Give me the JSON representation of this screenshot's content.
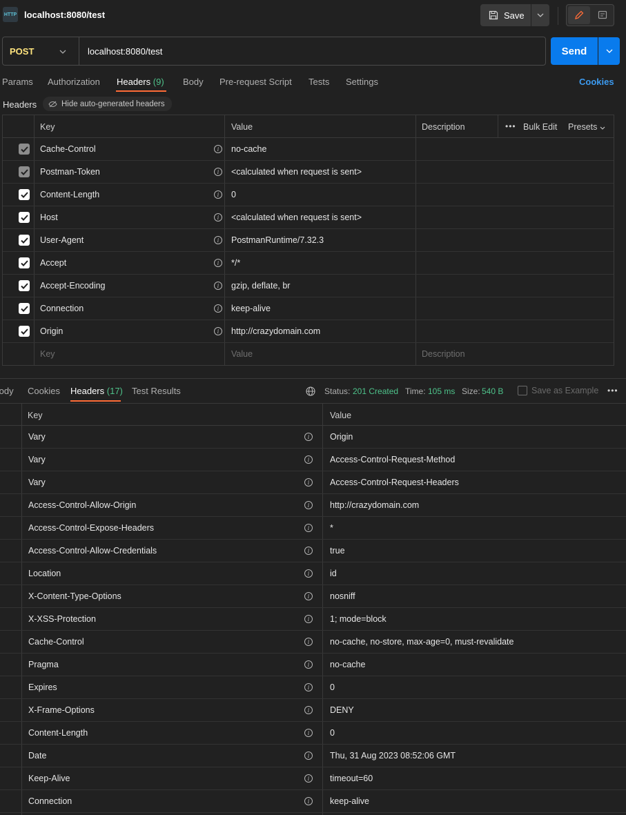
{
  "app": {
    "tab_icon": "HTTP",
    "tab_title": "localhost:8080/test",
    "save_label": "Save"
  },
  "request": {
    "method": "POST",
    "url": "localhost:8080/test",
    "send_label": "Send"
  },
  "request_tabs": [
    {
      "label": "Params"
    },
    {
      "label": "Authorization"
    },
    {
      "label": "Headers",
      "count": "(9)"
    },
    {
      "label": "Body"
    },
    {
      "label": "Pre-request Script"
    },
    {
      "label": "Tests"
    },
    {
      "label": "Settings"
    }
  ],
  "cookies_label": "Cookies",
  "headers_section": {
    "label": "Headers",
    "hide_auto_label": "Hide auto-generated headers"
  },
  "req_table": {
    "columns": {
      "key": "Key",
      "value": "Value",
      "description": "Description"
    },
    "bulk_edit": "Bulk Edit",
    "presets": "Presets",
    "rows": [
      {
        "key": "Cache-Control",
        "value": "no-cache",
        "auto": true
      },
      {
        "key": "Postman-Token",
        "value": "<calculated when request is sent>",
        "auto": true
      },
      {
        "key": "Content-Length",
        "value": "0",
        "auto": false
      },
      {
        "key": "Host",
        "value": "<calculated when request is sent>",
        "auto": false
      },
      {
        "key": "User-Agent",
        "value": "PostmanRuntime/7.32.3",
        "auto": false
      },
      {
        "key": "Accept",
        "value": "*/*",
        "auto": false
      },
      {
        "key": "Accept-Encoding",
        "value": "gzip, deflate, br",
        "auto": false
      },
      {
        "key": "Connection",
        "value": "keep-alive",
        "auto": false
      },
      {
        "key": "Origin",
        "value": "http://crazydomain.com",
        "auto": false
      }
    ],
    "placeholders": {
      "key": "Key",
      "value": "Value",
      "description": "Description"
    }
  },
  "response": {
    "tabs": [
      {
        "label": "Body"
      },
      {
        "label": "Cookies"
      },
      {
        "label": "Headers",
        "count": "(17)"
      },
      {
        "label": "Test Results"
      }
    ],
    "status_label": "Status:",
    "status_value": "201 Created",
    "time_label": "Time:",
    "time_value": "105 ms",
    "size_label": "Size:",
    "size_value": "540 B",
    "save_example": "Save as Example",
    "columns": {
      "key": "Key",
      "value": "Value"
    },
    "rows": [
      {
        "key": "Vary",
        "value": "Origin"
      },
      {
        "key": "Vary",
        "value": "Access-Control-Request-Method"
      },
      {
        "key": "Vary",
        "value": "Access-Control-Request-Headers"
      },
      {
        "key": "Access-Control-Allow-Origin",
        "value": "http://crazydomain.com"
      },
      {
        "key": "Access-Control-Expose-Headers",
        "value": "*"
      },
      {
        "key": "Access-Control-Allow-Credentials",
        "value": "true"
      },
      {
        "key": "Location",
        "value": "id"
      },
      {
        "key": "X-Content-Type-Options",
        "value": "nosniff"
      },
      {
        "key": "X-XSS-Protection",
        "value": "1; mode=block"
      },
      {
        "key": "Cache-Control",
        "value": "no-cache, no-store, max-age=0, must-revalidate"
      },
      {
        "key": "Pragma",
        "value": "no-cache"
      },
      {
        "key": "Expires",
        "value": "0"
      },
      {
        "key": "X-Frame-Options",
        "value": "DENY"
      },
      {
        "key": "Content-Length",
        "value": "0"
      },
      {
        "key": "Date",
        "value": "Thu, 31 Aug 2023 08:52:06 GMT"
      },
      {
        "key": "Keep-Alive",
        "value": "timeout=60"
      },
      {
        "key": "Connection",
        "value": "keep-alive"
      }
    ]
  },
  "colors": {
    "accent_orange": "#ff6c37",
    "send_blue": "#097bed",
    "method_yellow": "#ffe47e",
    "status_green": "#4ec28a",
    "link_blue": "#3c9bf1"
  },
  "icons": [
    "http-icon",
    "save-icon",
    "chevron-down-icon",
    "pencil-icon",
    "document-icon",
    "eye-slash-icon",
    "info-icon",
    "checkbox-icon",
    "globe-icon",
    "more-icon"
  ]
}
